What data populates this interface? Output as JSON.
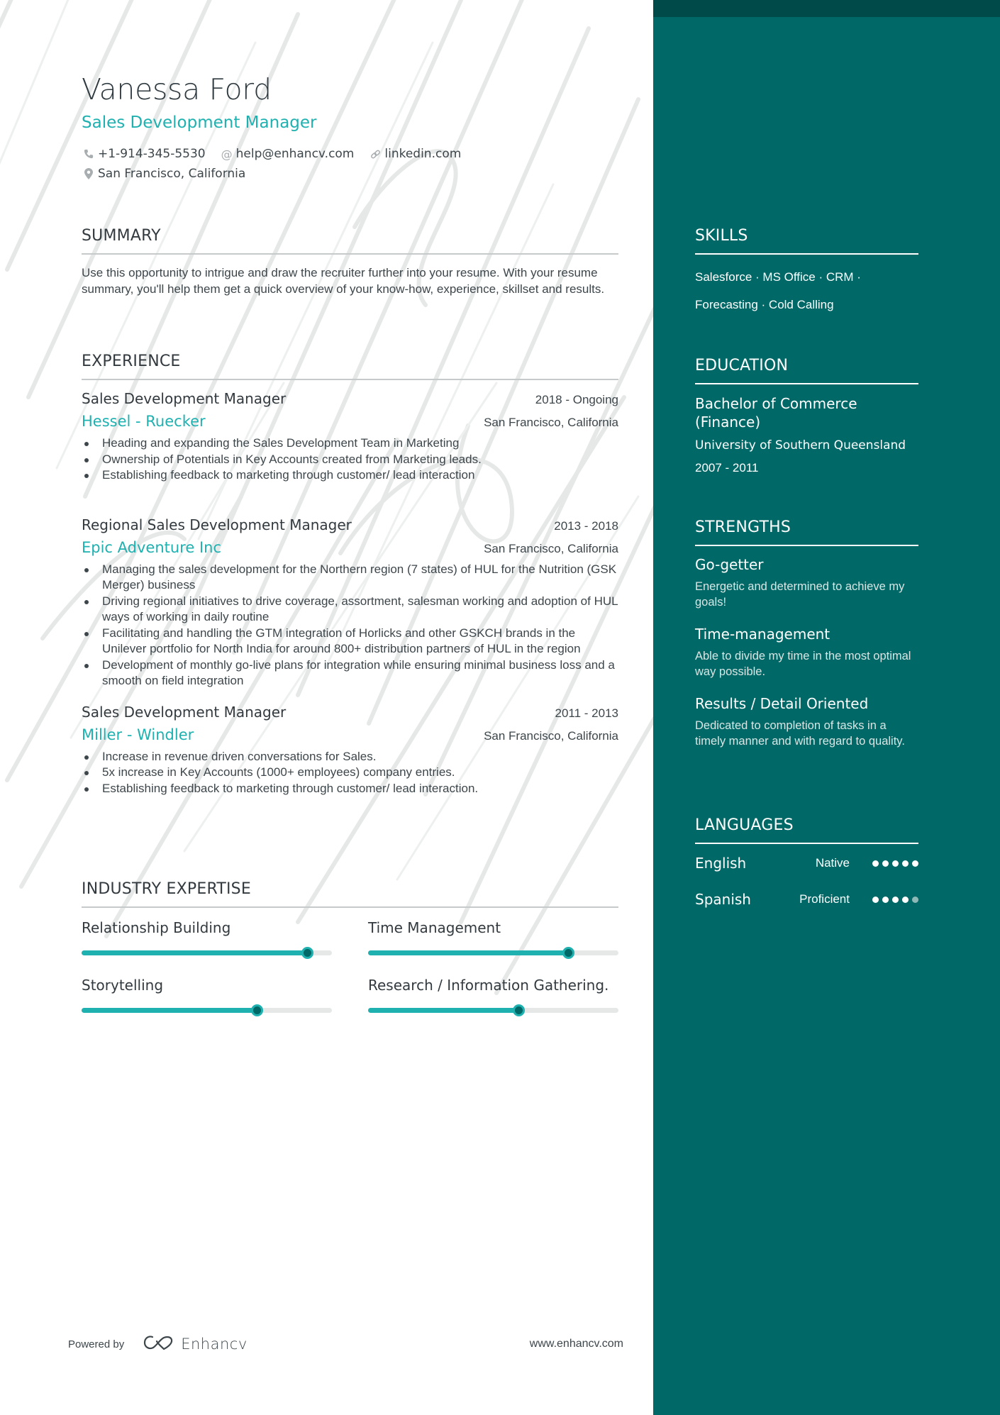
{
  "header": {
    "name": "Vanessa Ford",
    "headline": "Sales Development Manager",
    "contacts": [
      {
        "icon": "phone-icon",
        "text": "+1-914-345-5530"
      },
      {
        "icon": "at-icon",
        "text": "help@enhancv.com"
      },
      {
        "icon": "link-icon",
        "text": "linkedin.com"
      },
      {
        "icon": "location-pin-icon",
        "text": "San Francisco, California"
      }
    ]
  },
  "summary": {
    "title": "SUMMARY",
    "text": "Use this opportunity to intrigue and draw the recruiter further into your resume. With your resume summary, you'll help them get a quick overview of your know-how, experience, skillset and results."
  },
  "experience": {
    "title": "EXPERIENCE",
    "jobs": [
      {
        "title": "Sales Development Manager",
        "dates": "2018 - Ongoing",
        "company": "Hessel - Ruecker",
        "location": "San Francisco, California",
        "bullets": [
          "Heading and expanding the Sales Development Team in Marketing",
          "Ownership of Potentials in Key Accounts created from Marketing leads.",
          "Establishing feedback to marketing through customer/ lead interaction"
        ]
      },
      {
        "title": "Regional Sales Development Manager",
        "dates": "2013 - 2018",
        "company": "Epic Adventure Inc",
        "location": "San Francisco, California",
        "bullets": [
          "Managing the sales development for the Northern region (7 states) of HUL for the Nutrition (GSK Merger) business",
          "Driving regional initiatives to drive coverage, assortment, salesman working and adoption of HUL ways of working in daily routine",
          "Facilitating and handling the GTM integration of Horlicks and other GSKCH brands in the Unilever portfolio for North India for around 800+ distribution partners of HUL in the region",
          "Development of monthly go-live plans for integration while ensuring minimal business loss and a smooth on field integration"
        ]
      },
      {
        "title": "Sales Development Manager",
        "dates": "2011 - 2013",
        "company": "Miller - Windler",
        "location": "San Francisco, California",
        "bullets": [
          "Increase in revenue driven conversations for Sales.",
          "5x increase in Key Accounts (1000+ employees) company entries.",
          "Establishing feedback to marketing through customer/ lead interaction."
        ]
      }
    ]
  },
  "expertise": {
    "title": "INDUSTRY EXPERTISE",
    "items": [
      {
        "label": "Relationship Building",
        "level": 0.9
      },
      {
        "label": "Time Management",
        "level": 0.8
      },
      {
        "label": "Storytelling",
        "level": 0.7
      },
      {
        "label": "Research / Information Gathering.",
        "level": 0.6
      }
    ]
  },
  "footer": {
    "powered_by": "Powered by",
    "brand": "Enhancv",
    "site": "www.enhancv.com"
  },
  "sidebar": {
    "skills": {
      "title": "SKILLS",
      "line1": "Salesforce · MS Office · CRM ·",
      "line2": "Forecasting · Cold Calling"
    },
    "education": {
      "title": "EDUCATION",
      "degree": "Bachelor of Commerce (Finance)",
      "school": "University of Southern Queensland",
      "dates": "2007 - 2011"
    },
    "strengths": {
      "title": "STRENGTHS",
      "items": [
        {
          "title": "Go-getter",
          "desc": "Energetic and determined to achieve my goals!"
        },
        {
          "title": "Time-management",
          "desc": "Able to divide my time in the most optimal way possible."
        },
        {
          "title": "Results / Detail Oriented",
          "desc": "Dedicated to completion of tasks in a timely manner and with regard to quality."
        }
      ]
    },
    "languages": {
      "title": "LANGUAGES",
      "items": [
        {
          "name": "English",
          "level": "Native",
          "dots_filled": 5,
          "dots_total": 5
        },
        {
          "name": "Spanish",
          "level": "Proficient",
          "dots_filled": 4,
          "dots_total": 5
        }
      ]
    }
  },
  "colors": {
    "accent": "#1fb0b0",
    "sidebar": "#006866",
    "sidebar_top": "#004a4a",
    "text": "#333a3f"
  }
}
